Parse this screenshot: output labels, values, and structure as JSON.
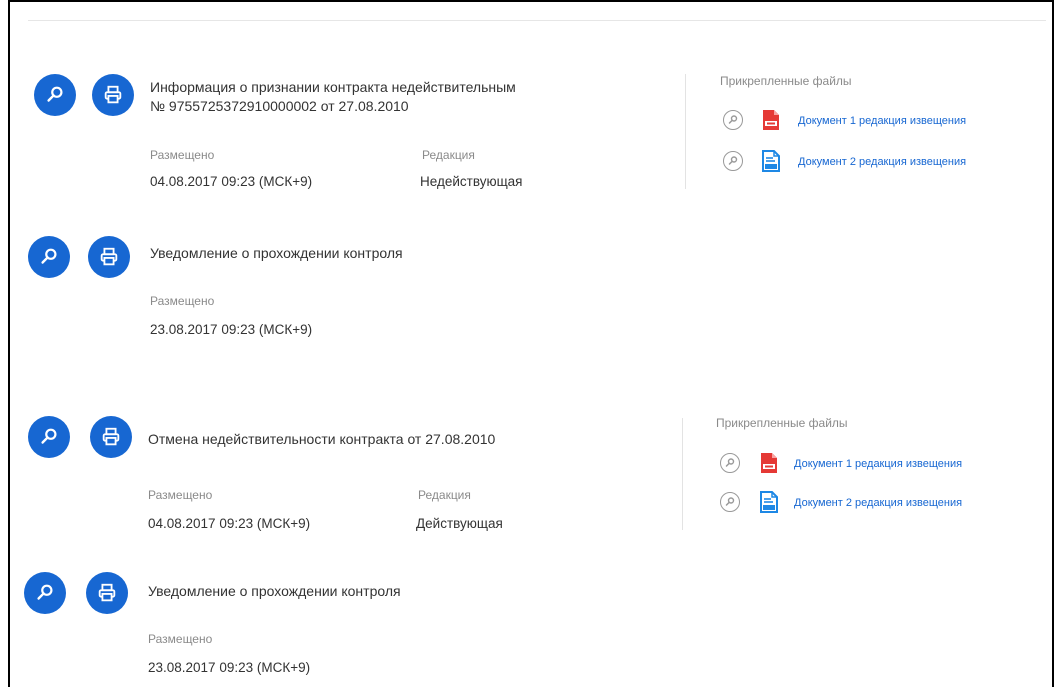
{
  "colors": {
    "accent": "#1767d2",
    "pdf": "#e53935",
    "docx": "#1e88e5",
    "muted": "#8a8a8a"
  },
  "entries": [
    {
      "title_line1": "Информация о признании контракта недействительным",
      "title_line2": "№ 9755725372910000002 от 27.08.2010",
      "placed_label": "Размещено",
      "placed_value": "04.08.2017  09:23 (МСК+9)",
      "edition_label": "Редакция",
      "edition_value": "Недействующая",
      "files_title": "Прикрепленные файлы",
      "files": [
        {
          "type": "pdf",
          "label": "Документ 1 редакция извещения"
        },
        {
          "type": "docx",
          "label": "Документ 2 редакция извещения"
        }
      ]
    },
    {
      "title_line1": "Уведомление о прохождении контроля",
      "placed_label": "Размещено",
      "placed_value": "23.08.2017 09:23 (МСК+9)"
    },
    {
      "title_line1": "Отмена недействительности контракта от 27.08.2010",
      "placed_label": "Размещено",
      "placed_value": "04.08.2017  09:23 (МСК+9)",
      "edition_label": "Редакция",
      "edition_value": "Действующая",
      "files_title": "Прикрепленные файлы",
      "files": [
        {
          "type": "pdf",
          "label": "Документ 1 редакция извещения"
        },
        {
          "type": "docx",
          "label": "Документ 2 редакция извещения"
        }
      ]
    },
    {
      "title_line1": "Уведомление о прохождении контроля",
      "placed_label": "Размещено",
      "placed_value": "23.08.2017 09:23 (МСК+9)"
    }
  ],
  "icons": {
    "view": "search-icon",
    "print": "print-icon",
    "file_view": "search-icon",
    "pdf": "pdf-file-icon",
    "docx": "docx-file-icon"
  }
}
